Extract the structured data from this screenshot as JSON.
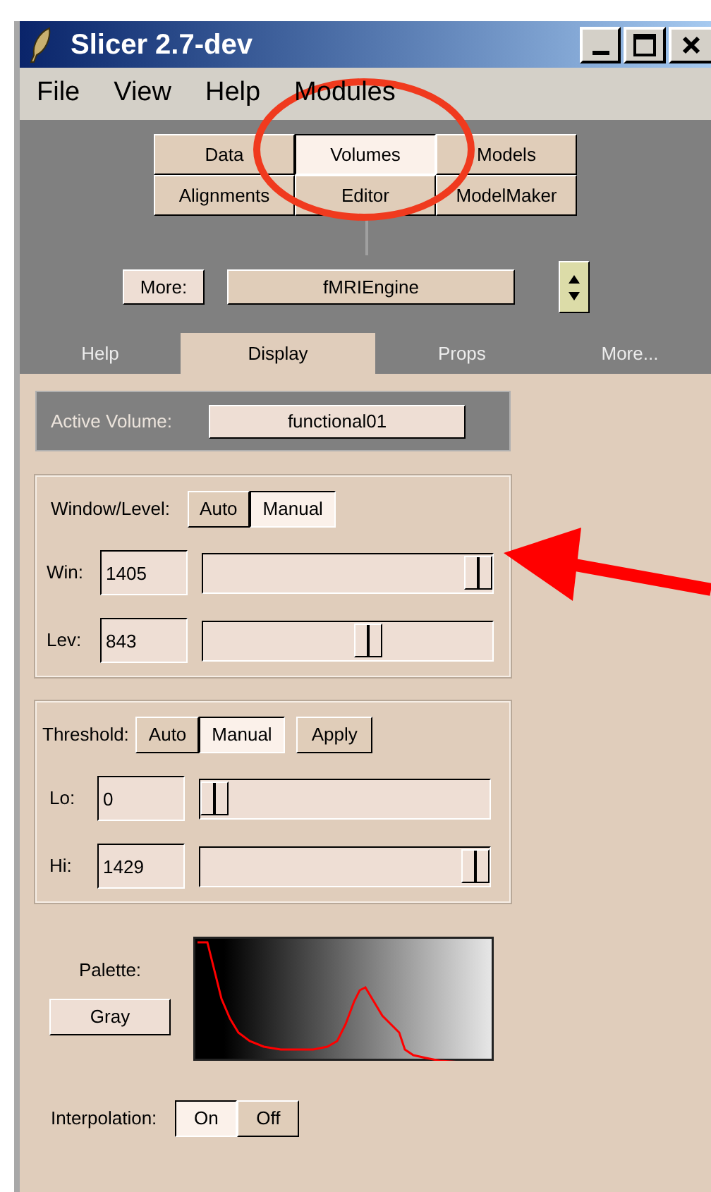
{
  "window": {
    "title": "Slicer 2.7-dev"
  },
  "menu": [
    "File",
    "View",
    "Help",
    "Modules"
  ],
  "modules": [
    {
      "label": "Data",
      "selected": false
    },
    {
      "label": "Volumes",
      "selected": true
    },
    {
      "label": "Models",
      "selected": false
    },
    {
      "label": "Alignments",
      "selected": false
    },
    {
      "label": "Editor",
      "selected": false
    },
    {
      "label": "ModelMaker",
      "selected": false
    }
  ],
  "more_button": "More:",
  "more_module": "fMRIEngine",
  "tabs": [
    {
      "label": "Help",
      "selected": false
    },
    {
      "label": "Display",
      "selected": true
    },
    {
      "label": "Props",
      "selected": false
    },
    {
      "label": "More...",
      "selected": false
    }
  ],
  "active_volume": {
    "label": "Active Volume:",
    "value": "functional01"
  },
  "window_level": {
    "label": "Window/Level:",
    "modes": [
      {
        "label": "Auto",
        "selected": false
      },
      {
        "label": "Manual",
        "selected": true
      }
    ],
    "rows": [
      {
        "label": "Win:",
        "value": "1405",
        "level": 1.0
      },
      {
        "label": "Lev:",
        "value": "843",
        "level": 0.58
      }
    ]
  },
  "threshold": {
    "label": "Threshold:",
    "modes": [
      {
        "label": "Auto",
        "selected": false
      },
      {
        "label": "Manual",
        "selected": true
      }
    ],
    "apply": "Apply",
    "rows": [
      {
        "label": "Lo:",
        "value": "0",
        "level": 0.0
      },
      {
        "label": "Hi:",
        "value": "1429",
        "level": 1.0
      }
    ]
  },
  "palette": {
    "label": "Palette:",
    "button": "Gray"
  },
  "interpolation": {
    "label": "Interpolation:",
    "options": [
      {
        "label": "On",
        "selected": true
      },
      {
        "label": "Off",
        "selected": false
      }
    ]
  }
}
